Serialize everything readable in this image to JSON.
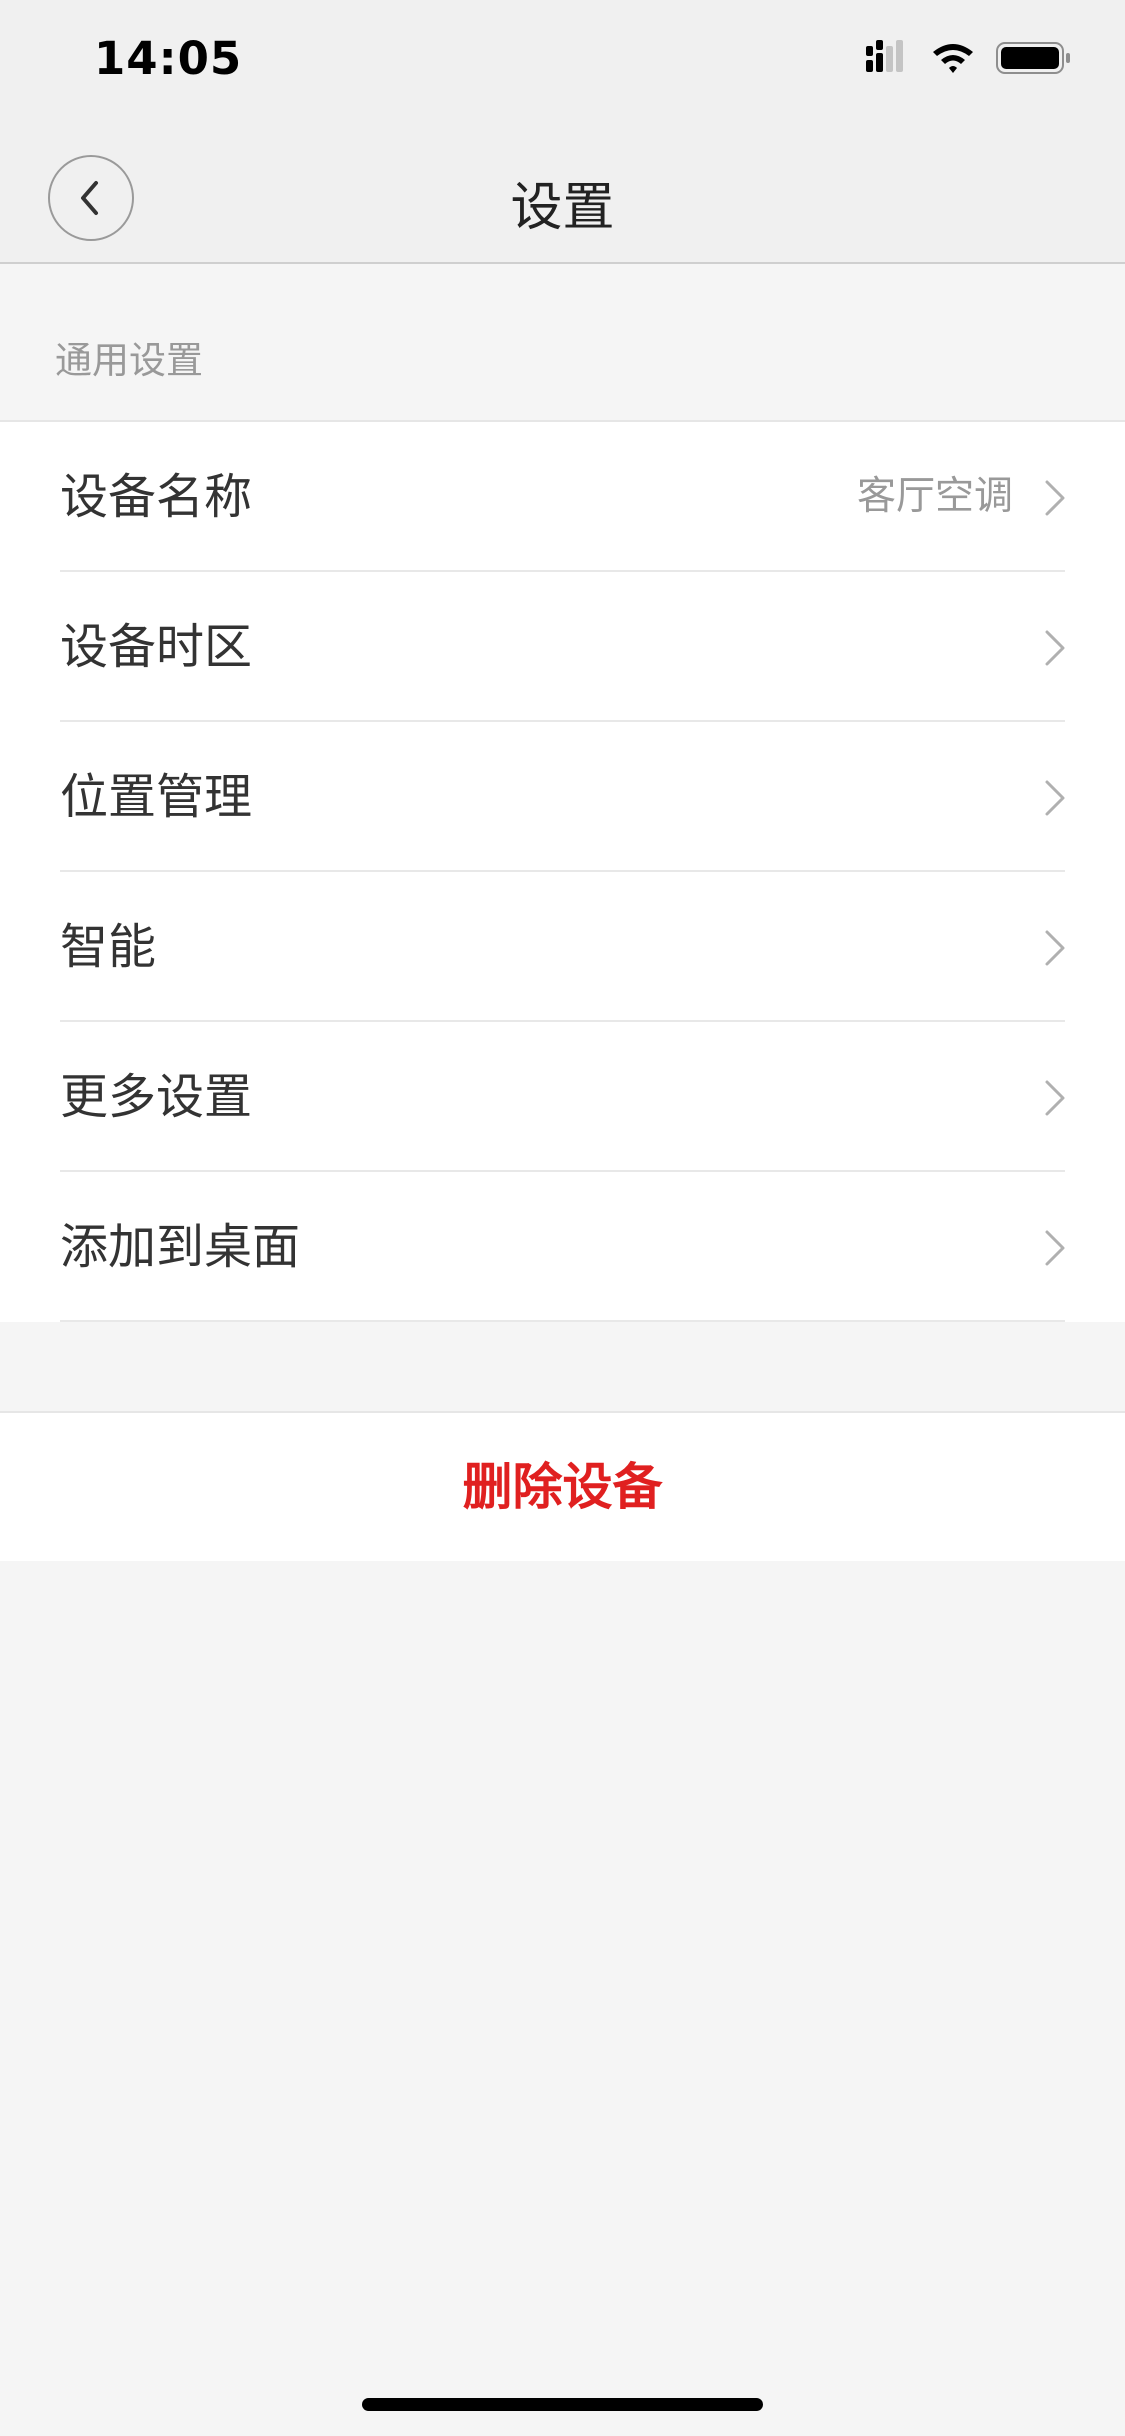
{
  "status_bar": {
    "time": "14:05",
    "icons": [
      "cellular-signal-icon",
      "wifi-icon",
      "battery-icon"
    ]
  },
  "nav": {
    "back_icon": "chevron-left-icon",
    "title": "设置"
  },
  "section": {
    "label": "通用设置"
  },
  "settings": [
    {
      "label": "设备名称",
      "value": "客厅空调"
    },
    {
      "label": "设备时区",
      "value": ""
    },
    {
      "label": "位置管理",
      "value": ""
    },
    {
      "label": "智能",
      "value": ""
    },
    {
      "label": "更多设置",
      "value": ""
    },
    {
      "label": "添加到桌面",
      "value": ""
    }
  ],
  "actions": {
    "delete_label": "删除设备",
    "delete_color": "#e02020"
  },
  "colors": {
    "header_bg": "#f0f0f0",
    "page_bg": "#f5f5f5",
    "secondary_text": "#999999"
  }
}
